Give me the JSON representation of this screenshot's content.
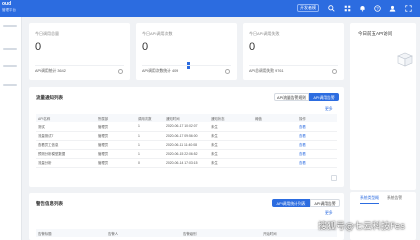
{
  "header": {
    "logo_line1": "oud",
    "logo_line2": "管理平台",
    "button_label": "开发者模"
  },
  "stats": [
    {
      "title": "今日调用总量",
      "value": "0",
      "footer": "API调用统计  3642"
    },
    {
      "title": "今日API调用次数",
      "value": "0",
      "footer": "API调用次数统计  409"
    },
    {
      "title": "今日API调用失败",
      "value": "0",
      "footer": "API总调用失败  9761"
    }
  ],
  "right_panel": {
    "title": "今日前五API访问"
  },
  "flow_table": {
    "title": "流量通知列表",
    "segments": [
      "API流量告警规则",
      "API调用告警"
    ],
    "more": "更多",
    "headers": [
      "API名称",
      "所属部",
      "调用次数",
      "通知时间",
      "通知状态",
      "阈值",
      "操作"
    ],
    "rows": [
      [
        "测试",
        "管理员",
        "1",
        "2020-06-17 10:02:07",
        "未生",
        "",
        "查看"
      ],
      [
        "流量测试7",
        "管理员",
        "1",
        "2020-06-17 09:56:00",
        "未生",
        "",
        "查看"
      ],
      [
        "查看员工信息",
        "管理员",
        "1",
        "2020-06-11 11:40:08",
        "未生",
        "",
        "查看"
      ],
      [
        "预测分析模型数据",
        "管理员",
        "1",
        "2020-06-15 22:06:52",
        "未生",
        "",
        "查看"
      ],
      [
        "流量分析",
        "管理员",
        "0",
        "2020-06-14 17:03:15",
        "未生",
        "",
        "查看"
      ]
    ]
  },
  "alert_table": {
    "title": "警告信息列表",
    "segments": [
      "API调用统计列表",
      "API调用告警"
    ],
    "more": "更多",
    "headers": [
      "告警标题",
      "告警人",
      "告警级别",
      "开始时间"
    ]
  },
  "bottom_tabs": [
    "系统类型概",
    "系统告警"
  ],
  "watermark": "搜狐号@七云科技Fes"
}
